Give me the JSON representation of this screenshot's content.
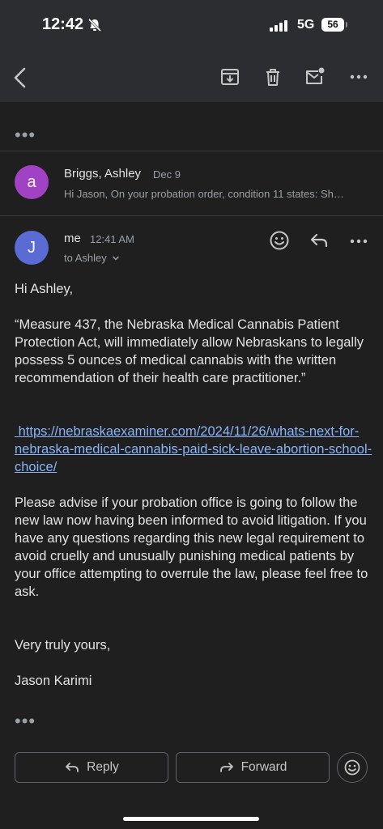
{
  "status_bar": {
    "time": "12:42",
    "network": "5G",
    "battery": "56"
  },
  "toolbar": {
    "back_icon": "chevron-left-icon",
    "archive_icon": "archive-icon",
    "delete_icon": "trash-icon",
    "mark_unread_icon": "mail-unread-icon",
    "more_icon": "more-horizontal-icon"
  },
  "thread": {
    "collapsed_dots": "•••",
    "previous_message": {
      "avatar_letter": "a",
      "avatar_color": "#a142c4",
      "sender": "Briggs, Ashley",
      "date": "Dec 9",
      "snippet": "Hi Jason, On your probation order, condition 11 states: Sh…"
    },
    "current_message": {
      "avatar_letter": "J",
      "avatar_color": "#5b6bd4",
      "sender": "me",
      "time": "12:41 AM",
      "to": "to Ashley",
      "greeting": "Hi Ashley,",
      "quote": "“Measure 437, the Nebraska Medical Cannabis Patient Protection Act, will immediately allow Nebraskans to legally possess 5 ounces of medical cannabis with the written recommendation of their health care practitioner.”",
      "link": "https://nebraskaexaminer.com/2024/11/26/whats-next-for-nebraska-medical-cannabis-paid-sick-leave-abortion-school-choice/",
      "paragraph": "Please advise if your probation office is going to follow the new law now having been informed to avoid litigation. If you have any questions regarding this new legal requirement to avoid cruelly and unusually punishing medical patients by your office attempting to overrule the law, please feel free to ask.",
      "closing": "Very truly yours,",
      "signature": "Jason Karimi",
      "trimmed_dots": "•••"
    }
  },
  "actions": {
    "reply_label": "Reply",
    "forward_label": "Forward"
  }
}
